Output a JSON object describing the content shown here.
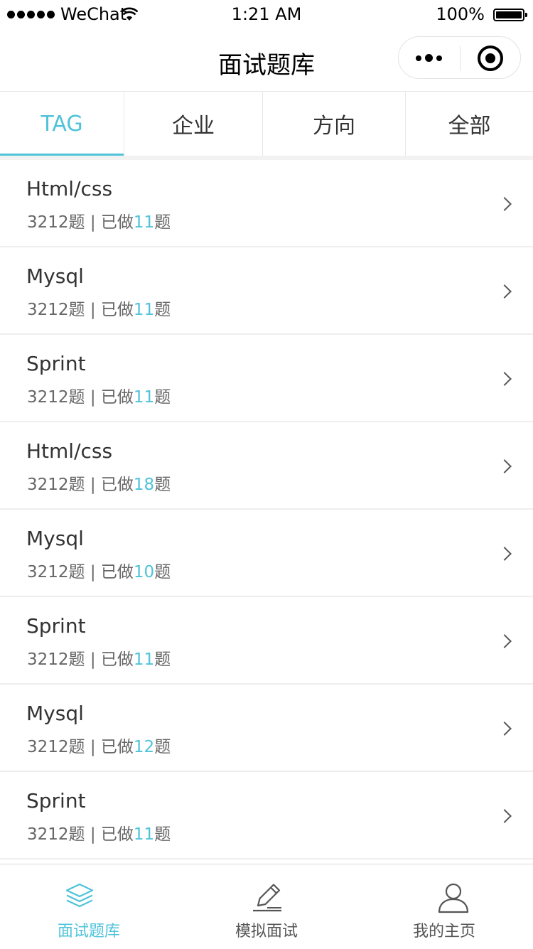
{
  "status_bar": {
    "carrier": "WeChat",
    "time": "1:21 AM",
    "battery": "100%"
  },
  "nav": {
    "title": "面试题库"
  },
  "tabs": [
    {
      "label": "TAG",
      "active": true
    },
    {
      "label": "企业",
      "active": false
    },
    {
      "label": "方向",
      "active": false
    },
    {
      "label": "全部",
      "active": false
    }
  ],
  "list": [
    {
      "title": "Html/css",
      "total": "3212题",
      "sep": " | ",
      "done_prefix": "已做",
      "done": "11",
      "done_suffix": "题"
    },
    {
      "title": "Mysql",
      "total": "3212题",
      "sep": " | ",
      "done_prefix": "已做",
      "done": "11",
      "done_suffix": "题"
    },
    {
      "title": "Sprint",
      "total": "3212题",
      "sep": " | ",
      "done_prefix": "已做",
      "done": "11",
      "done_suffix": "题"
    },
    {
      "title": "Html/css",
      "total": "3212题",
      "sep": " | ",
      "done_prefix": "已做",
      "done": "18",
      "done_suffix": "题"
    },
    {
      "title": "Mysql",
      "total": "3212题",
      "sep": " | ",
      "done_prefix": "已做",
      "done": "10",
      "done_suffix": "题"
    },
    {
      "title": "Sprint",
      "total": "3212题",
      "sep": " | ",
      "done_prefix": "已做",
      "done": "11",
      "done_suffix": "题"
    },
    {
      "title": "Mysql",
      "total": "3212题",
      "sep": " | ",
      "done_prefix": "已做",
      "done": "12",
      "done_suffix": "题"
    },
    {
      "title": "Sprint",
      "total": "3212题",
      "sep": " | ",
      "done_prefix": "已做",
      "done": "11",
      "done_suffix": "题"
    }
  ],
  "tab_bar": [
    {
      "label": "面试题库",
      "icon": "layers-icon",
      "active": true
    },
    {
      "label": "模拟面试",
      "icon": "pencil-icon",
      "active": false
    },
    {
      "label": "我的主页",
      "icon": "user-icon",
      "active": false
    }
  ],
  "colors": {
    "accent": "#4fc3d9",
    "text": "#333333",
    "meta": "#666666",
    "divider": "#eeeeee"
  }
}
